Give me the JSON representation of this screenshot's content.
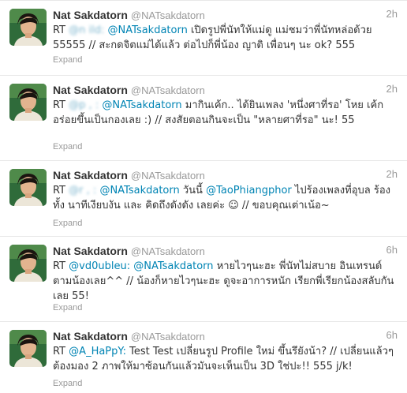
{
  "author": {
    "fullname": "Nat Sakdatorn",
    "username": "@NATsakdatorn"
  },
  "expand_label": "Expand",
  "tweets": [
    {
      "time": "2h",
      "rt": "RT",
      "mention_1": "@n   ild:",
      "mention_2": "@NATsakdatorn",
      "body": "เปิดรูปพี่นัทให้แม่ดู แม่ชมว่าพี่นัทหล่อด้วย 55555 // สะกดจิตแม่ได้แล้ว ต่อไปก็พี่น้อง ญาติ เพื่อนๆ นะ ok? 555"
    },
    {
      "time": "2h",
      "rt": "RT",
      "mention_1": "@p     ,   :",
      "mention_2": "@NATsakdatorn",
      "body": "มากินเค้ก.. ได้ยินเพลง 'หนึ่งศาที่รอ' โหย เค้กอร่อยขึ้นเป็นกองเลย :) // สงสัยตอนกินจะเป็น \"หลายศาที่รอ\" นะ! 55"
    },
    {
      "time": "2h",
      "rt": "RT",
      "mention_1": "@r     ,   :",
      "mention_2": "@NATsakdatorn",
      "body_a": "วันนี้",
      "mention_3": "@TaoPhiangphor",
      "body_b": "ไปร้องเพลงที่อุบล ร้องทั้ง นาทีเงียบงัน และ คิดถึงดังดัง เลยค่ะ ☺ // ขอบคุณเต่าเน้อ~"
    },
    {
      "time": "6h",
      "rt": "RT",
      "mention_1": "@vd0ubleu:",
      "mention_2": "@NATsakdatorn",
      "body": "หายไวๆนะฮะ พี่นัทไม่สบาย อินเทรนด์ตามน้องเลย^^ // น้องก็หายไวๆนะฮะ ดูจะอาการหนัก เรียกพี่เรียกน้องสลับกันเลย 55!"
    },
    {
      "time": "6h",
      "rt": "RT",
      "mention_1": "@A_HaPpY:",
      "body": "Test Test เปลี่ยนรูป Profile ใหม่ ขึ้นรึยังน้า? // เปลี่ยนแล้วๆ ต้องมอง 2 ภาพให้มาซ้อนกันแล้วมันจะเห็นเป็น 3D ใช่ปะ!! 555 j/k!"
    }
  ]
}
